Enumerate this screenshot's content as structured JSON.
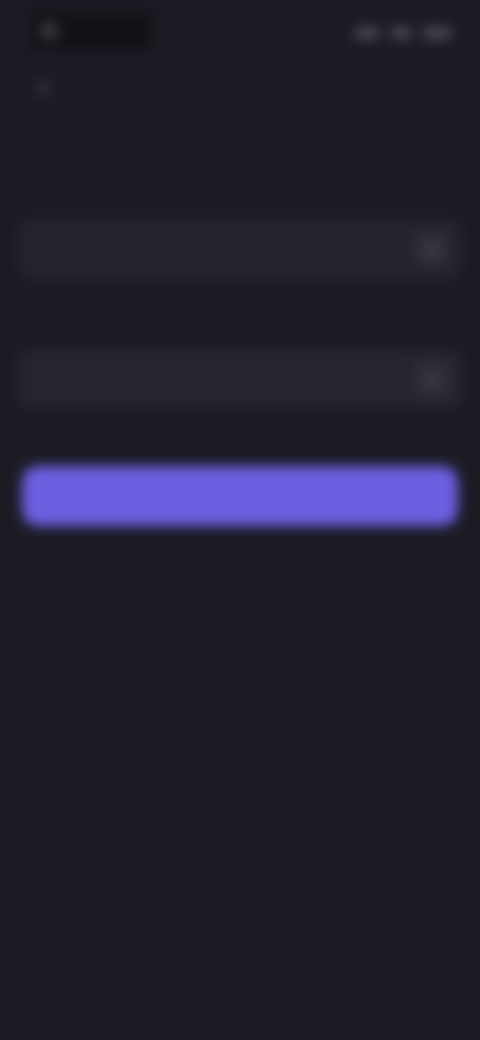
{
  "status_bar": {
    "left_text": "",
    "right_icons": [
      "signal-icon",
      "wifi-icon",
      "battery-icon"
    ]
  },
  "header": {
    "back_icon": "arrow-left-icon",
    "title": ""
  },
  "form": {
    "field_1": {
      "label": "",
      "value": "",
      "placeholder": "",
      "icon": "field-action-icon"
    },
    "hint": "",
    "field_2": {
      "label": "",
      "value": "",
      "placeholder": "",
      "icon": "field-action-icon"
    },
    "primary_button": ""
  },
  "footer": {
    "note": ""
  },
  "colors": {
    "background": "#1b1b24",
    "input_background": "#23232d",
    "accent": "#6b5fe0",
    "title_text": "#bdbdc4"
  }
}
